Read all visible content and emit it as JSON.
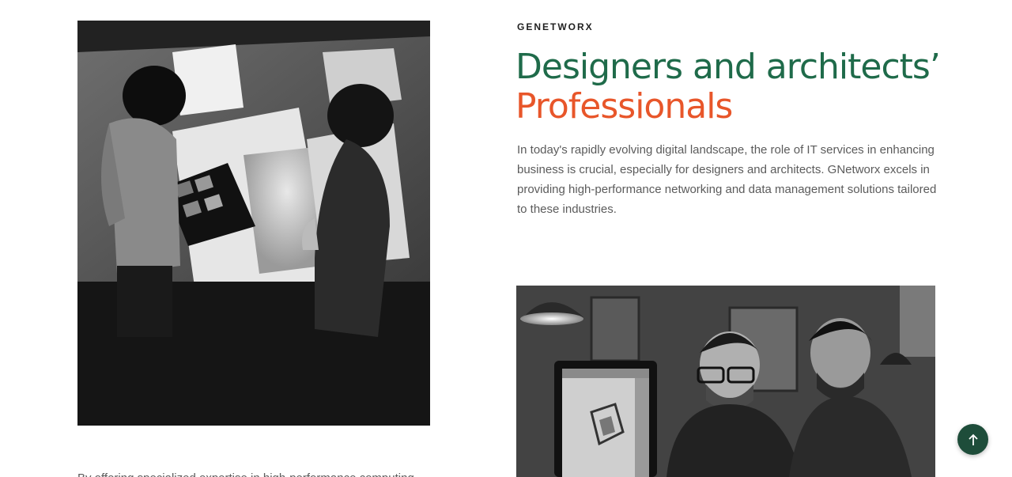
{
  "section": {
    "eyebrow": "GENETWORX",
    "headline_line1": "Designers and architects’",
    "headline_line2": "Professionals",
    "intro": "In today's rapidly evolving digital landscape, the role of IT services in enhancing business is crucial, especially for designers and architects. GNetworx excels in providing high-performance networking and data management solutions tailored to these industries.",
    "bottom_text": "By offering specialized expertise in high-performance computing"
  },
  "images": {
    "left": "designers-at-table-photo",
    "right": "architects-at-computer-photo"
  },
  "controls": {
    "back_to_top_icon": "arrow-up-icon"
  },
  "colors": {
    "headline_green": "#1f6b4a",
    "headline_orange": "#e8562a",
    "button_bg": "#1e4d3a"
  }
}
